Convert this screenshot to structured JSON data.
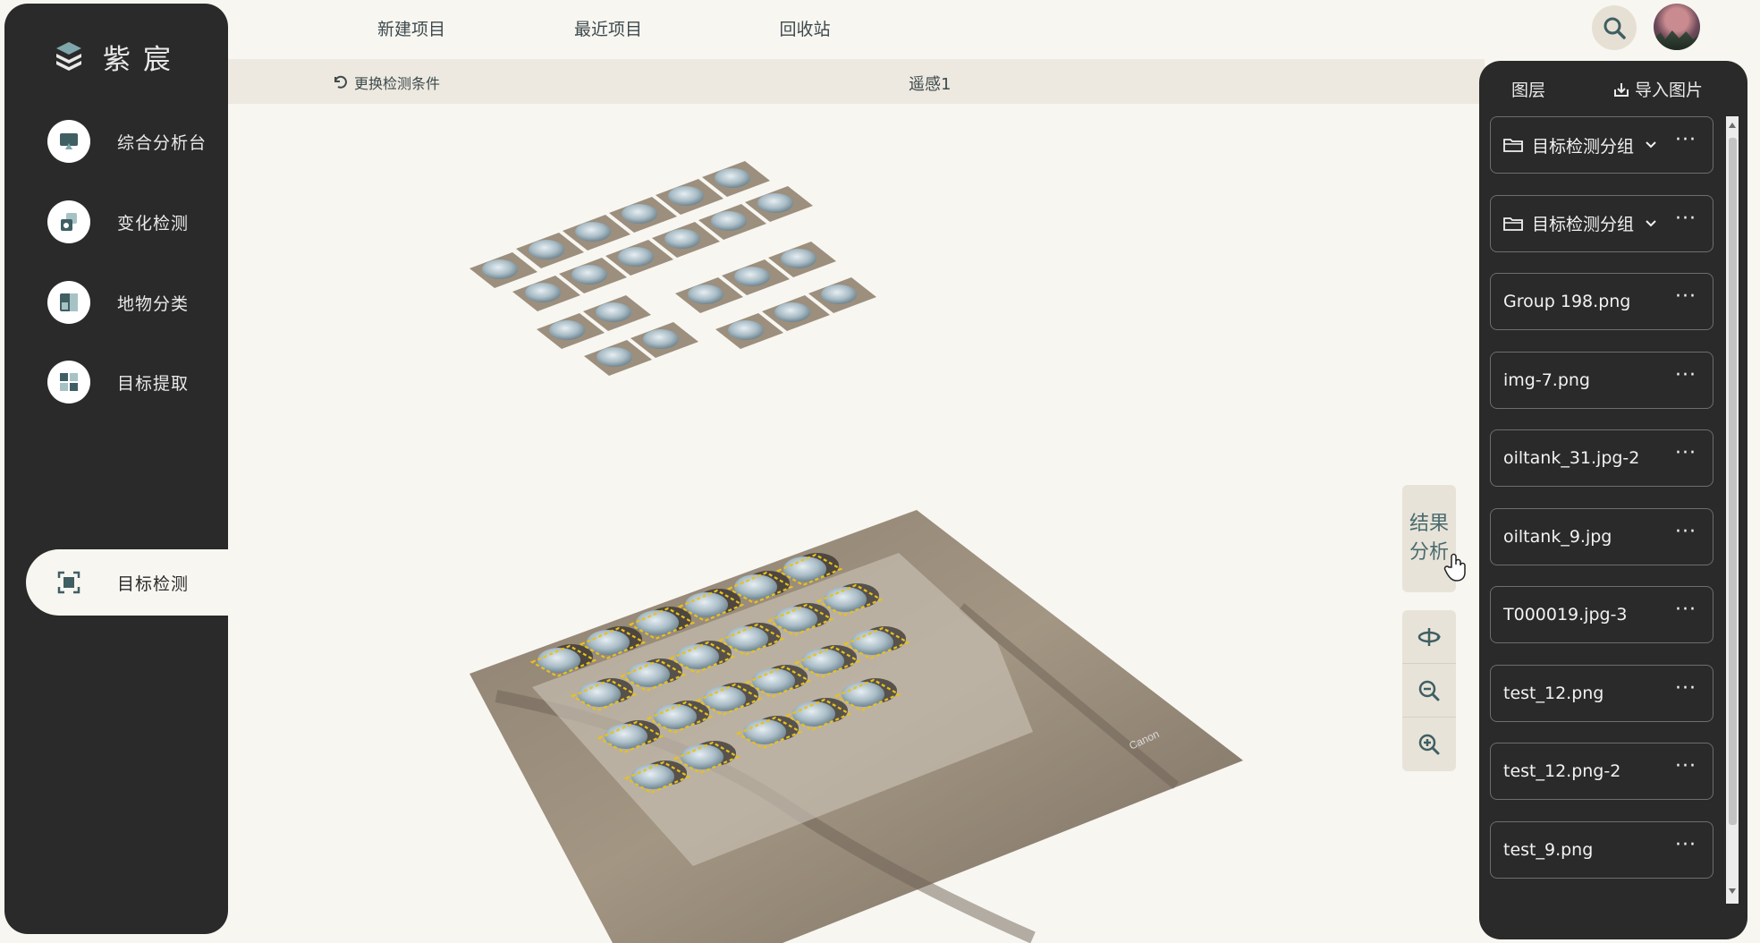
{
  "brand": {
    "name": "紫宸"
  },
  "sidebar": {
    "items": [
      {
        "label": "综合分析台",
        "icon": "monitor-icon"
      },
      {
        "label": "变化检测",
        "icon": "layers-icon"
      },
      {
        "label": "地物分类",
        "icon": "panel-icon"
      },
      {
        "label": "目标提取",
        "icon": "grid-icon"
      },
      {
        "label": "目标检测",
        "icon": "target-frame-icon",
        "active": true
      }
    ]
  },
  "topnav": {
    "items": [
      "新建项目",
      "最近项目",
      "回收站"
    ]
  },
  "toolbar": {
    "change_conditions": "更换检测条件",
    "project_title": "遥感1"
  },
  "tools": {
    "result_analysis": "结果分析",
    "rotate": "rotate-icon",
    "zoom_out": "zoom-out-icon",
    "zoom_in": "zoom-in-icon"
  },
  "layers": {
    "tab_label": "图层",
    "import_label": "导入图片",
    "items": [
      {
        "name": "目标检测分组",
        "type": "group"
      },
      {
        "name": "目标检测分组",
        "type": "group"
      },
      {
        "name": "Group 198.png",
        "type": "image"
      },
      {
        "name": "img-7.png",
        "type": "image"
      },
      {
        "name": "oiltank_31.jpg-2",
        "type": "image"
      },
      {
        "name": "oiltank_9.jpg",
        "type": "image"
      },
      {
        "name": "T000019.jpg-3",
        "type": "image"
      },
      {
        "name": "test_12.png",
        "type": "image"
      },
      {
        "name": "test_12.png-2",
        "type": "image"
      },
      {
        "name": "test_9.png",
        "type": "image"
      }
    ],
    "more_symbol": "···"
  },
  "colors": {
    "sidebar_bg": "#2a2a2a",
    "page_bg": "#f8f6f1",
    "accent": "#4a6b70",
    "detection_box": "#e8c21a"
  }
}
